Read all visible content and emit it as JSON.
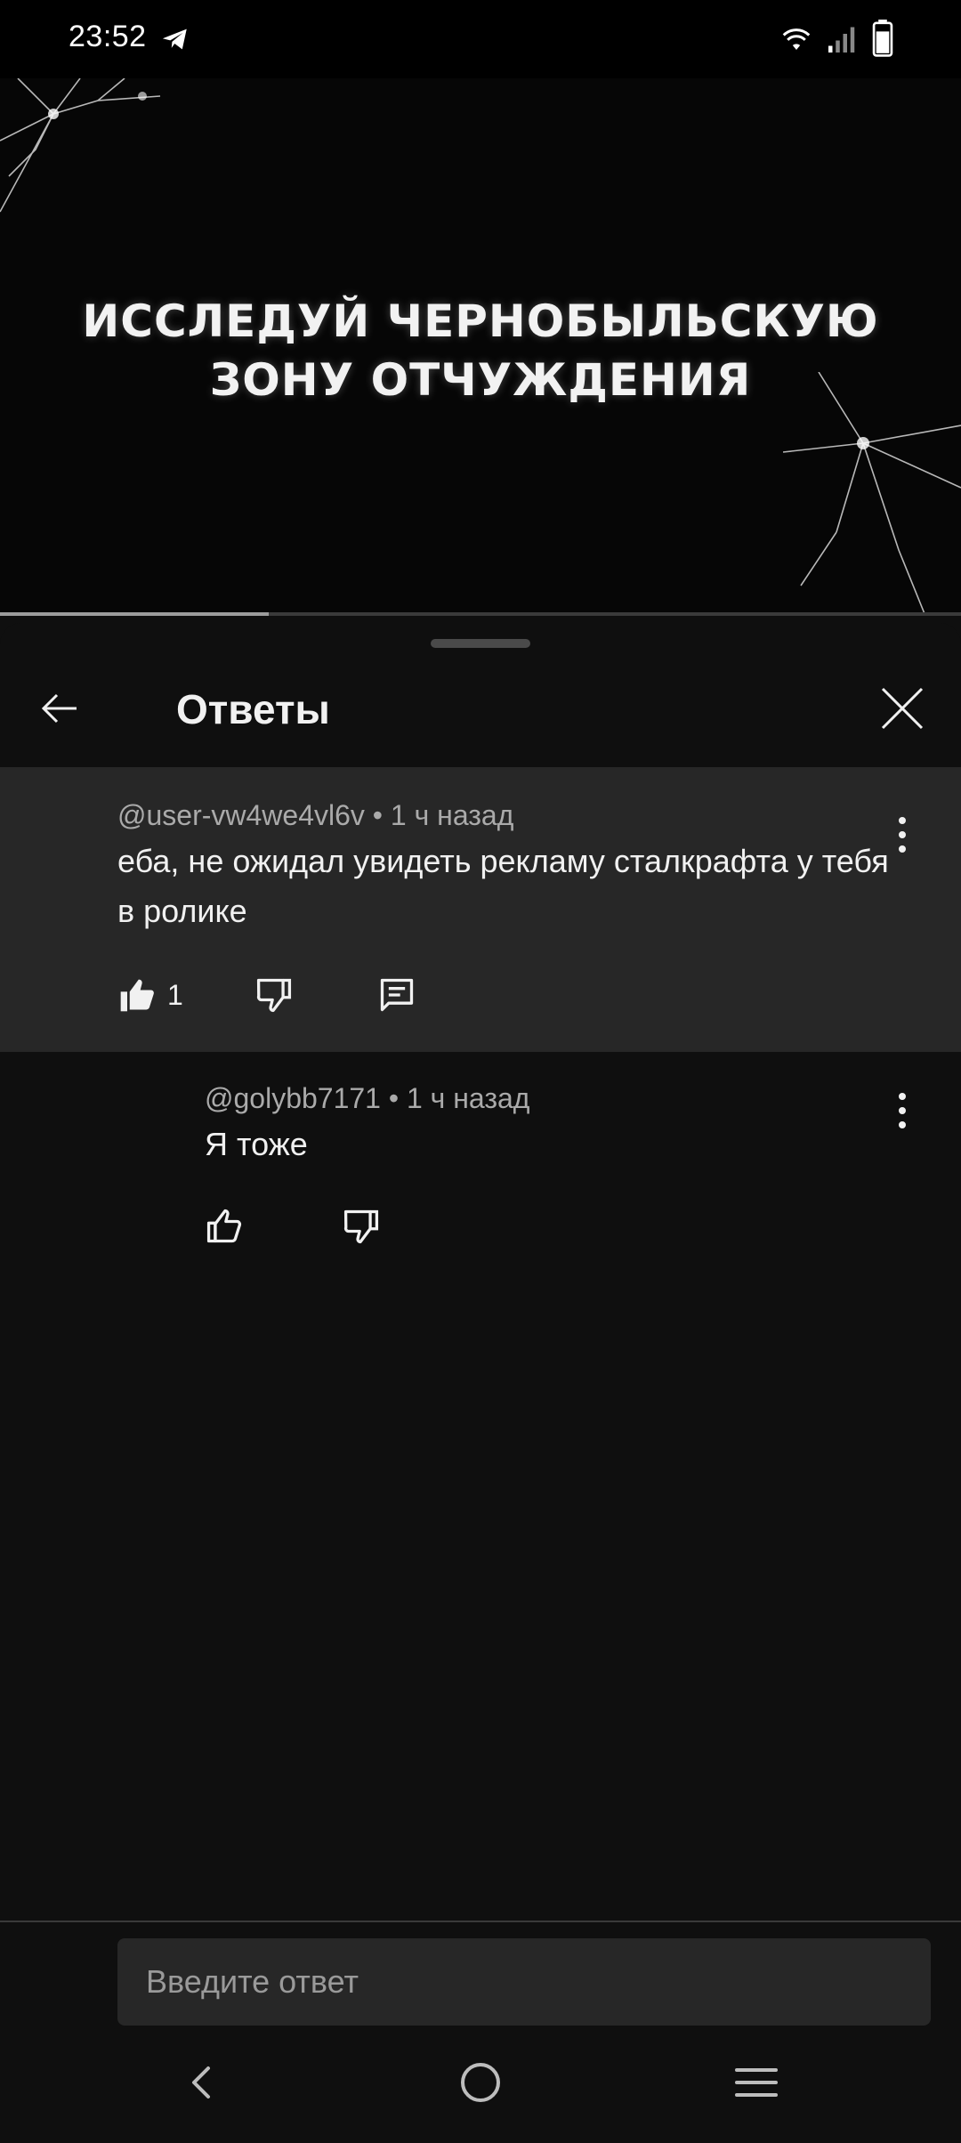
{
  "status_bar": {
    "time": "23:52",
    "icons": [
      "telegram-icon",
      "wifi-icon",
      "signal-icon",
      "battery-icon"
    ]
  },
  "video": {
    "title_line1": "ИССЛЕДУЙ ЧЕРНОБЫЛЬСКУЮ",
    "title_line2": "ЗОНУ ОТЧУЖДЕНИЯ",
    "progress_fraction": 0.28
  },
  "sheet": {
    "title": "Ответы",
    "back_icon": "arrow-left-icon",
    "close_icon": "close-icon"
  },
  "parent_comment": {
    "author": "@user-vw4we4vl6v",
    "time": "• 1 ч назад",
    "text": "еба, не ожидал увидеть рекламу сталкрафта у тебя в ролике",
    "like_count": "1",
    "liked": true
  },
  "reply": {
    "author": "@golybb7171",
    "time": "• 1 ч назад",
    "text": "Я тоже"
  },
  "reply_input": {
    "placeholder": "Введите ответ"
  },
  "nav_bar": {
    "icons": [
      "back-nav-icon",
      "home-nav-icon",
      "recents-nav-icon"
    ]
  },
  "colors": {
    "background": "#0f0f0f",
    "highlight": "#272727",
    "secondary_text": "#aaaaaa"
  }
}
